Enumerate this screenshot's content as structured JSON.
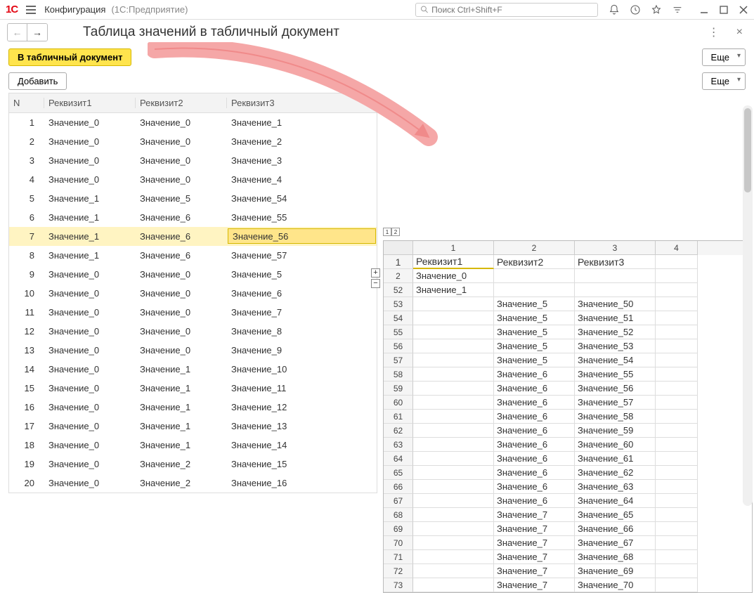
{
  "titlebar": {
    "app": "Конфигурация",
    "subtitle": "(1С:Предприятие)",
    "search_placeholder": "Поиск Ctrl+Shift+F"
  },
  "nav": {
    "page_title": "Таблица значений в табличный документ"
  },
  "toolbar1": {
    "to_tabdoc": "В табличный документ",
    "more": "Еще"
  },
  "toolbar2": {
    "add": "Добавить",
    "more": "Еще"
  },
  "value_table": {
    "headers": {
      "n": "N",
      "r1": "Реквизит1",
      "r2": "Реквизит2",
      "r3": "Реквизит3"
    },
    "selected_index": 6,
    "rows": [
      {
        "n": 1,
        "r1": "Значение_0",
        "r2": "Значение_0",
        "r3": "Значение_1"
      },
      {
        "n": 2,
        "r1": "Значение_0",
        "r2": "Значение_0",
        "r3": "Значение_2"
      },
      {
        "n": 3,
        "r1": "Значение_0",
        "r2": "Значение_0",
        "r3": "Значение_3"
      },
      {
        "n": 4,
        "r1": "Значение_0",
        "r2": "Значение_0",
        "r3": "Значение_4"
      },
      {
        "n": 5,
        "r1": "Значение_1",
        "r2": "Значение_5",
        "r3": "Значение_54"
      },
      {
        "n": 6,
        "r1": "Значение_1",
        "r2": "Значение_6",
        "r3": "Значение_55"
      },
      {
        "n": 7,
        "r1": "Значение_1",
        "r2": "Значение_6",
        "r3": "Значение_56"
      },
      {
        "n": 8,
        "r1": "Значение_1",
        "r2": "Значение_6",
        "r3": "Значение_57"
      },
      {
        "n": 9,
        "r1": "Значение_0",
        "r2": "Значение_0",
        "r3": "Значение_5"
      },
      {
        "n": 10,
        "r1": "Значение_0",
        "r2": "Значение_0",
        "r3": "Значение_6"
      },
      {
        "n": 11,
        "r1": "Значение_0",
        "r2": "Значение_0",
        "r3": "Значение_7"
      },
      {
        "n": 12,
        "r1": "Значение_0",
        "r2": "Значение_0",
        "r3": "Значение_8"
      },
      {
        "n": 13,
        "r1": "Значение_0",
        "r2": "Значение_0",
        "r3": "Значение_9"
      },
      {
        "n": 14,
        "r1": "Значение_0",
        "r2": "Значение_1",
        "r3": "Значение_10"
      },
      {
        "n": 15,
        "r1": "Значение_0",
        "r2": "Значение_1",
        "r3": "Значение_11"
      },
      {
        "n": 16,
        "r1": "Значение_0",
        "r2": "Значение_1",
        "r3": "Значение_12"
      },
      {
        "n": 17,
        "r1": "Значение_0",
        "r2": "Значение_1",
        "r3": "Значение_13"
      },
      {
        "n": 18,
        "r1": "Значение_0",
        "r2": "Значение_1",
        "r3": "Значение_14"
      },
      {
        "n": 19,
        "r1": "Значение_0",
        "r2": "Значение_2",
        "r3": "Значение_15"
      },
      {
        "n": 20,
        "r1": "Значение_0",
        "r2": "Значение_2",
        "r3": "Значение_16"
      }
    ]
  },
  "sheet": {
    "col_headers": [
      "1",
      "2",
      "3",
      "4"
    ],
    "title_row": {
      "n": "1",
      "c1": "Реквизит1",
      "c2": "Реквизит2",
      "c3": "Реквизит3"
    },
    "fold_controls": [
      "+",
      "−"
    ],
    "outline_levels": [
      "1",
      "2"
    ],
    "rows": [
      {
        "n": "2",
        "c1": "Значение_0",
        "c2": "",
        "c3": ""
      },
      {
        "n": "52",
        "c1": "Значение_1",
        "c2": "",
        "c3": ""
      },
      {
        "n": "53",
        "c1": "",
        "c2": "Значение_5",
        "c3": "Значение_50"
      },
      {
        "n": "54",
        "c1": "",
        "c2": "Значение_5",
        "c3": "Значение_51"
      },
      {
        "n": "55",
        "c1": "",
        "c2": "Значение_5",
        "c3": "Значение_52"
      },
      {
        "n": "56",
        "c1": "",
        "c2": "Значение_5",
        "c3": "Значение_53"
      },
      {
        "n": "57",
        "c1": "",
        "c2": "Значение_5",
        "c3": "Значение_54"
      },
      {
        "n": "58",
        "c1": "",
        "c2": "Значение_6",
        "c3": "Значение_55"
      },
      {
        "n": "59",
        "c1": "",
        "c2": "Значение_6",
        "c3": "Значение_56"
      },
      {
        "n": "60",
        "c1": "",
        "c2": "Значение_6",
        "c3": "Значение_57"
      },
      {
        "n": "61",
        "c1": "",
        "c2": "Значение_6",
        "c3": "Значение_58"
      },
      {
        "n": "62",
        "c1": "",
        "c2": "Значение_6",
        "c3": "Значение_59"
      },
      {
        "n": "63",
        "c1": "",
        "c2": "Значение_6",
        "c3": "Значение_60"
      },
      {
        "n": "64",
        "c1": "",
        "c2": "Значение_6",
        "c3": "Значение_61"
      },
      {
        "n": "65",
        "c1": "",
        "c2": "Значение_6",
        "c3": "Значение_62"
      },
      {
        "n": "66",
        "c1": "",
        "c2": "Значение_6",
        "c3": "Значение_63"
      },
      {
        "n": "67",
        "c1": "",
        "c2": "Значение_6",
        "c3": "Значение_64"
      },
      {
        "n": "68",
        "c1": "",
        "c2": "Значение_7",
        "c3": "Значение_65"
      },
      {
        "n": "69",
        "c1": "",
        "c2": "Значение_7",
        "c3": "Значение_66"
      },
      {
        "n": "70",
        "c1": "",
        "c2": "Значение_7",
        "c3": "Значение_67"
      },
      {
        "n": "71",
        "c1": "",
        "c2": "Значение_7",
        "c3": "Значение_68"
      },
      {
        "n": "72",
        "c1": "",
        "c2": "Значение_7",
        "c3": "Значение_69"
      },
      {
        "n": "73",
        "c1": "",
        "c2": "Значение_7",
        "c3": "Значение_70"
      }
    ]
  }
}
